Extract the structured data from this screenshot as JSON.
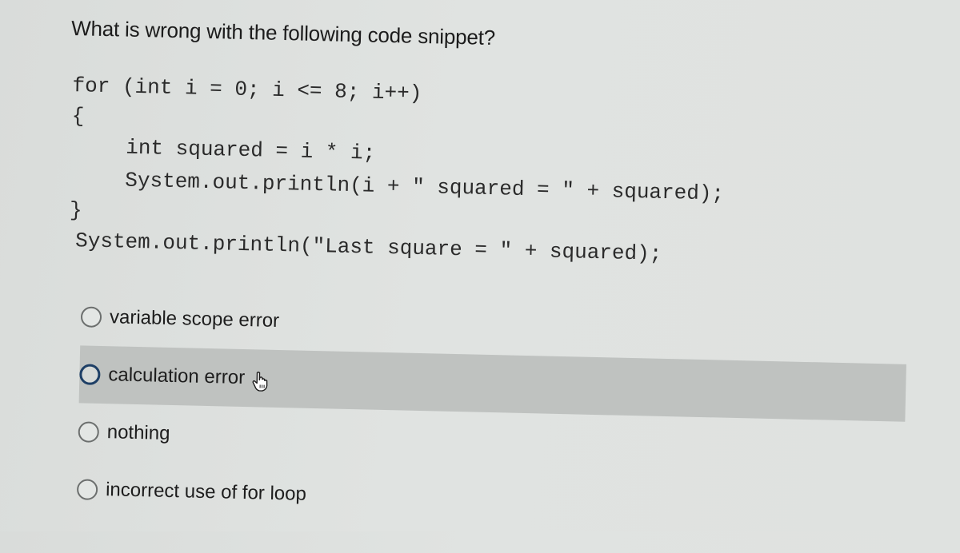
{
  "question": {
    "title": "What is wrong with the following code snippet?",
    "code_lines": [
      "for (int i = 0; i <= 8; i++)",
      "{",
      "    int squared = i * i;",
      "    System.out.println(i + \" squared = \" + squared);",
      "}",
      "System.out.println(\"Last square = \" + squared);"
    ]
  },
  "options": [
    {
      "label": "variable scope error",
      "selected": false,
      "hovered": false
    },
    {
      "label": "calculation error",
      "selected": false,
      "hovered": true
    },
    {
      "label": "nothing",
      "selected": false,
      "hovered": false
    },
    {
      "label": "incorrect use of for loop",
      "selected": false,
      "hovered": false
    }
  ],
  "cursor": {
    "icon": "hand-pointer-icon"
  },
  "colors": {
    "background": "#dfe2e0",
    "hover_row": "#bfc2c0",
    "focus_ring": "#1e3f66",
    "text": "#1d1d1d"
  }
}
